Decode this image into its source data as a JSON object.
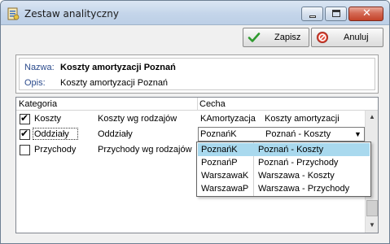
{
  "window": {
    "title": "Zestaw analityczny",
    "close_glyph": "✕"
  },
  "toolbar": {
    "save_label": "Zapisz",
    "cancel_label": "Anuluj"
  },
  "header": {
    "name_label": "Nazwa:",
    "name_value": "Koszty amortyzacji Poznań",
    "desc_label": "Opis:",
    "desc_value": "Koszty amortyzacji Poznań"
  },
  "grid": {
    "columns": [
      "Kategoria",
      "Cecha"
    ],
    "rows": [
      {
        "checked": true,
        "category": "Koszty",
        "category_name": "Koszty wg rodzajów",
        "feature_code": "KAmortyzacja",
        "feature_name": "Koszty amortyzacji"
      },
      {
        "checked": true,
        "category": "Oddziały",
        "category_name": "Oddziały",
        "feature_code": "PoznańK",
        "feature_name": "Poznań - Koszty"
      },
      {
        "checked": false,
        "category": "Przychody",
        "category_name": "Przychody wg rodzajów",
        "feature_code": "",
        "feature_name": ""
      }
    ]
  },
  "dropdown": {
    "items": [
      {
        "code": "PoznańK",
        "name": "Poznań - Koszty",
        "selected": true
      },
      {
        "code": "PoznańP",
        "name": "Poznań - Przychody",
        "selected": false
      },
      {
        "code": "WarszawaK",
        "name": "Warszawa - Koszty",
        "selected": false
      },
      {
        "code": "WarszawaP",
        "name": "Warszawa - Przychody",
        "selected": false
      }
    ]
  },
  "glyphs": {
    "check": "✔",
    "arrow_down": "▼",
    "arrow_up": "▲"
  },
  "colors": {
    "selected_item": "#a9d9ee",
    "label_blue": "#2a4a8c"
  }
}
